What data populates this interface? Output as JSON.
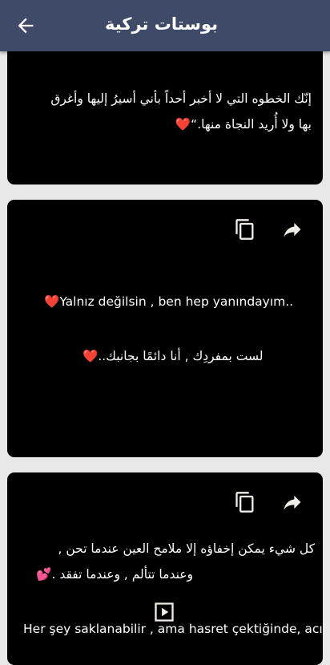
{
  "app_bar": {
    "title": "بوستات تركية",
    "back_icon": "arrow-back-icon"
  },
  "posts": [
    {
      "lines": [
        "إنّك الخطوه التي لا أخبر أحداً بأني أسيرُ إليها وأغرق",
        "بها ولا أُريد النجاة منها.“"
      ],
      "emoji": "❤️"
    },
    {
      "actions": {
        "share_icon": "share-arrow-icon",
        "copy_icon": "copy-icon"
      },
      "lines": [
        "Yalnız değilsin , ben hep yanındayım..",
        "لست بمفردِك , أنا دائمًا بجانبك.."
      ],
      "emoji": "❤️"
    },
    {
      "actions": {
        "share_icon": "share-arrow-icon",
        "copy_icon": "copy-icon"
      },
      "lines": [
        "كل شيء يمكن إخفاؤه إلا ملامح العين عندما تحن ,",
        "وعندما تتألم , وعندما تفقد .",
        "Her şey saklanabilir , ama hasret çektiğinde, acı"
      ],
      "emoji": "💕",
      "media_icon": "play-icon"
    }
  ]
}
